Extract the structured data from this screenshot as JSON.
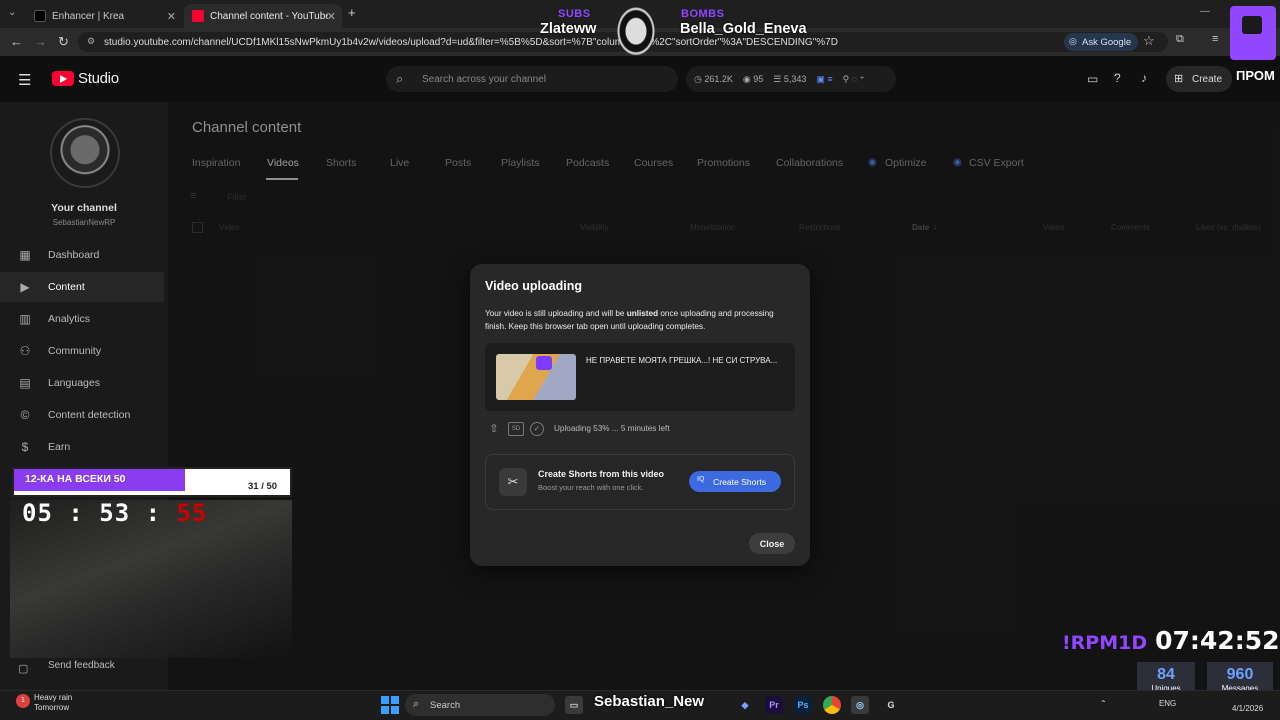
{
  "browser": {
    "tabs": [
      {
        "title": "Enhancer | Krea",
        "active": false
      },
      {
        "title": "Channel content - YouTube Stu",
        "active": true
      }
    ],
    "url": "studio.youtube.com/channel/UCDf1MKl15sNwPkmUy1b4v2w/videos/upload?d=ud&filter=%5B%5D&sort=%7B\"columnTy...\"%2C\"sortOrder\"%3A\"DESCENDING\"%7D",
    "ask_google_label": "Ask Google",
    "new_tab_symbol": "+"
  },
  "studio": {
    "logo_text": "Studio",
    "search_placeholder": "Search across your channel",
    "stats": {
      "views": "261.2K",
      "watching": "95",
      "subs": "5,343"
    },
    "create_label": "Create"
  },
  "sidebar": {
    "channel_label": "Your channel",
    "channel_name": "SebastianNewRP",
    "items": [
      {
        "label": "Dashboard",
        "icon": "dashboard-icon"
      },
      {
        "label": "Content",
        "icon": "content-icon",
        "selected": true
      },
      {
        "label": "Analytics",
        "icon": "analytics-icon"
      },
      {
        "label": "Community",
        "icon": "community-icon"
      },
      {
        "label": "Languages",
        "icon": "languages-icon"
      },
      {
        "label": "Content detection",
        "icon": "copyright-icon"
      },
      {
        "label": "Earn",
        "icon": "dollar-icon"
      }
    ],
    "feedback_label": "Send feedback"
  },
  "main": {
    "title": "Channel content",
    "tabs": [
      "Inspiration",
      "Videos",
      "Shorts",
      "Live",
      "Posts",
      "Playlists",
      "Podcasts",
      "Courses",
      "Promotions",
      "Collaborations",
      "Optimize",
      "CSV Export"
    ],
    "selected_tab": "Videos",
    "filter_placeholder": "Filter",
    "columns": [
      "Video",
      "Visibility",
      "Monetization",
      "Restrictions",
      "Date",
      "Views",
      "Comments",
      "Likes (vs. dislikes)"
    ]
  },
  "modal": {
    "title": "Video uploading",
    "body_prefix": "Your video is still uploading and will be ",
    "body_bold": "unlisted",
    "body_suffix": " once uploading and processing finish. Keep this browser tab open until uploading completes.",
    "video_title": "НЕ ПРАВЕТЕ МОЯТА ГРЕШКА...! НЕ СИ СТРУВА...",
    "upload_status": "Uploading 53% ... 5 minutes left",
    "upload_progress": 0.53,
    "sd_badge": "SD",
    "shorts_title": "Create Shorts from this video",
    "shorts_subtitle": "Boost your reach with one click.",
    "create_shorts_label": "Create Shorts",
    "create_shorts_badge": "IQ",
    "close_label": "Close",
    "accent_color": "#3e6ae1"
  },
  "stream_overlay": {
    "subs_label": "SUBS",
    "subs_name": "Zlateww",
    "bombs_label": "BOMBS",
    "bombs_name": "Bella_Gold_Eneva",
    "prom_label": "ПРОМ",
    "goal_label": "12-КА НА ВСЕКИ 50",
    "goal_count": "31 / 50",
    "goal_progress": 0.62,
    "timer_h": "05",
    "timer_m": "53",
    "timer_s": "55",
    "timer_sep": ":",
    "rpm_label": "!RPM1D",
    "clock": "07:42:52",
    "uniques_value": "84",
    "uniques_label": "Uniques",
    "messages_value": "960",
    "messages_label": "Messages",
    "accent_color": "#9146ff"
  },
  "taskbar": {
    "weather_title": "Heavy rain",
    "weather_sub": "Tomorrow",
    "search_label": "Search",
    "streamer_name": "Sebastian_New",
    "lang": "ENG",
    "date": "4/1/2026",
    "notif_count": "1"
  }
}
